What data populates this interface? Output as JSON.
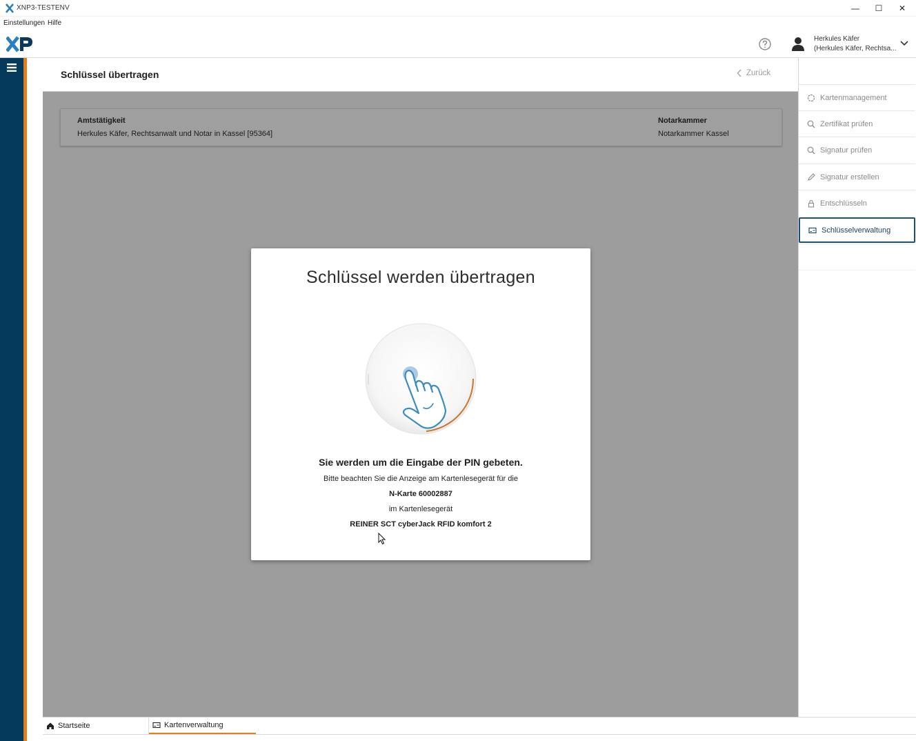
{
  "window": {
    "title": "XNP3-TESTENV",
    "minimize": "—",
    "maximize": "☐",
    "close": "✕"
  },
  "menu": [
    "Einstellungen",
    "Hilfe"
  ],
  "header": {
    "user_name": "Herkules Käfer",
    "user_role": "(Herkules Käfer, Rechtsa..."
  },
  "page": {
    "title": "Schlüssel übertragen",
    "back": "Zurück"
  },
  "info": {
    "amt_label": "Amtstätigkeit",
    "amt_value": "Herkules Käfer, Rechtsanwalt und Notar in Kassel [95364]",
    "kammer_label": "Notarkammer",
    "kammer_value": "Notarkammer Kassel"
  },
  "sidebar": {
    "items": [
      {
        "label": "Kartenmanagement",
        "icon": "circle-icon"
      },
      {
        "label": "Zertifikat prüfen",
        "icon": "search-icon"
      },
      {
        "label": "Signatur prüfen",
        "icon": "search-icon"
      },
      {
        "label": "Signatur erstellen",
        "icon": "pen-icon"
      },
      {
        "label": "Entschlüsseln",
        "icon": "lock-icon"
      },
      {
        "label": "Schlüsselverwaltung",
        "icon": "key-card-icon",
        "active": true
      }
    ]
  },
  "modal": {
    "title": "Schlüssel werden übertragen",
    "heading": "Sie werden um die Eingabe der PIN gebeten.",
    "line1": "Bitte beachten Sie die Anzeige am Kartenlesegerät für die",
    "card": "N-Karte 60002887",
    "line2": "im Kartenlesegerät",
    "reader": "REINER SCT cyberJack RFID komfort 2"
  },
  "tabs": [
    "Startseite",
    "Kartenverwaltung"
  ],
  "colors": {
    "rail_blue": "#063a5c",
    "accent_orange": "#e17f1c",
    "active_border": "#1c4f74",
    "overlay_gray": "#9d9d9d"
  }
}
